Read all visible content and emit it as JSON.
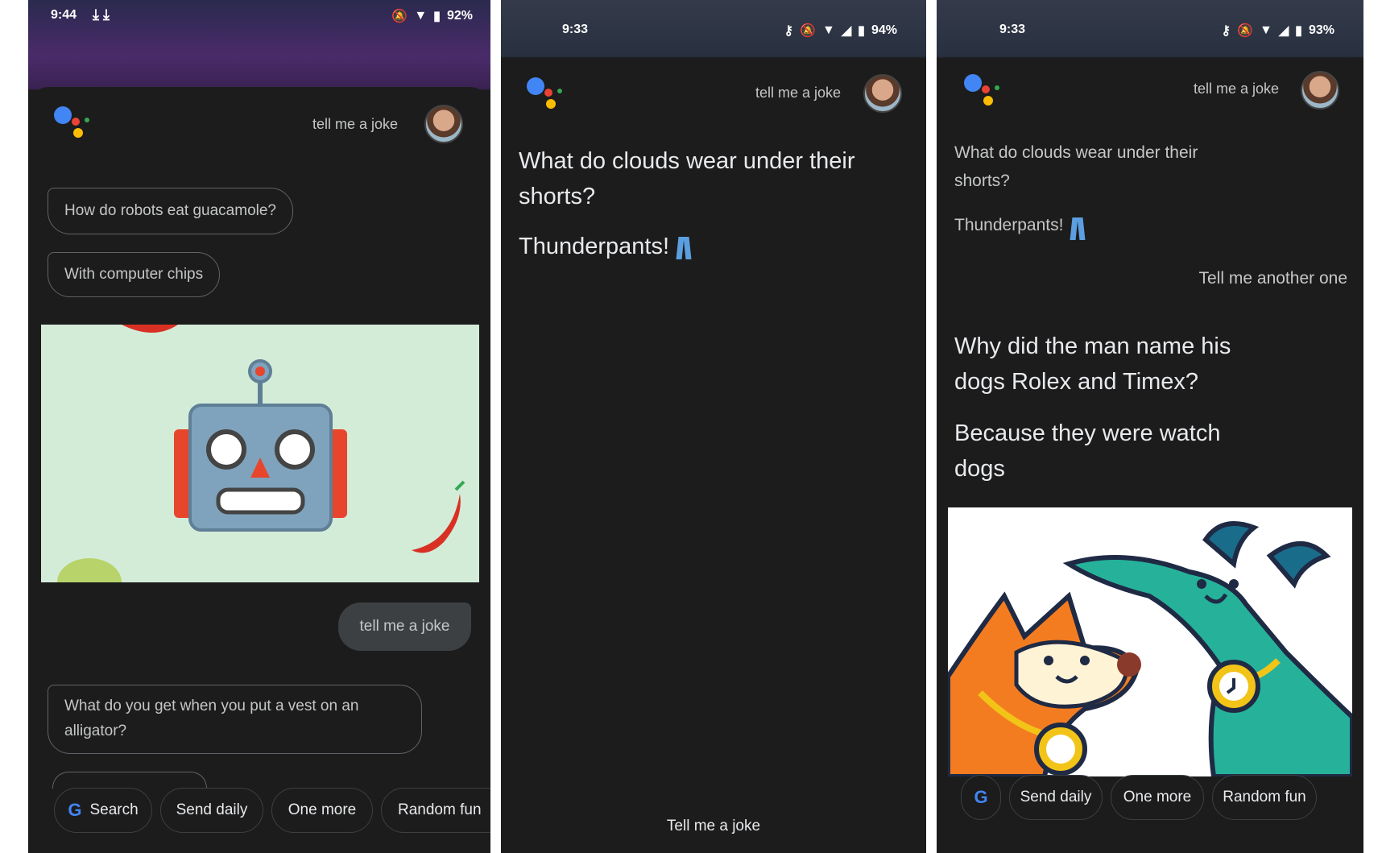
{
  "panel1": {
    "status": {
      "time": "9:44",
      "battery": "92%"
    },
    "query": "tell me a joke",
    "bubbles": [
      "How do robots eat guacamole?",
      "With computer chips"
    ],
    "user_bubble": "tell me a joke",
    "bubble3": "What do you get when you put a vest on an alligator?",
    "chips": [
      "Search",
      "Send daily",
      "One more",
      "Random fun"
    ]
  },
  "panel2": {
    "status": {
      "time": "9:33",
      "battery": "94%"
    },
    "query": "tell me a joke",
    "question": "What do clouds wear under their shorts?",
    "answer": "Thunderpants!",
    "hint": "Tell me a joke"
  },
  "panel3": {
    "status": {
      "time": "9:33",
      "battery": "93%"
    },
    "query": "tell me a joke",
    "question": "What do clouds wear under their shorts?",
    "answer": "Thunderpants!",
    "user_line": "Tell me another one",
    "question2": "Why did the man name his dogs Rolex and Timex?",
    "answer2": "Because they were watch dogs",
    "chips": [
      "Send daily",
      "One more",
      "Random fun"
    ]
  },
  "colors": {
    "google_blue": "#4285f4",
    "google_red": "#ea4335",
    "google_yellow": "#fbbc05",
    "google_green": "#34a853",
    "robot_bg": "#d3ecd8",
    "dog_bg": "#ffffff"
  }
}
